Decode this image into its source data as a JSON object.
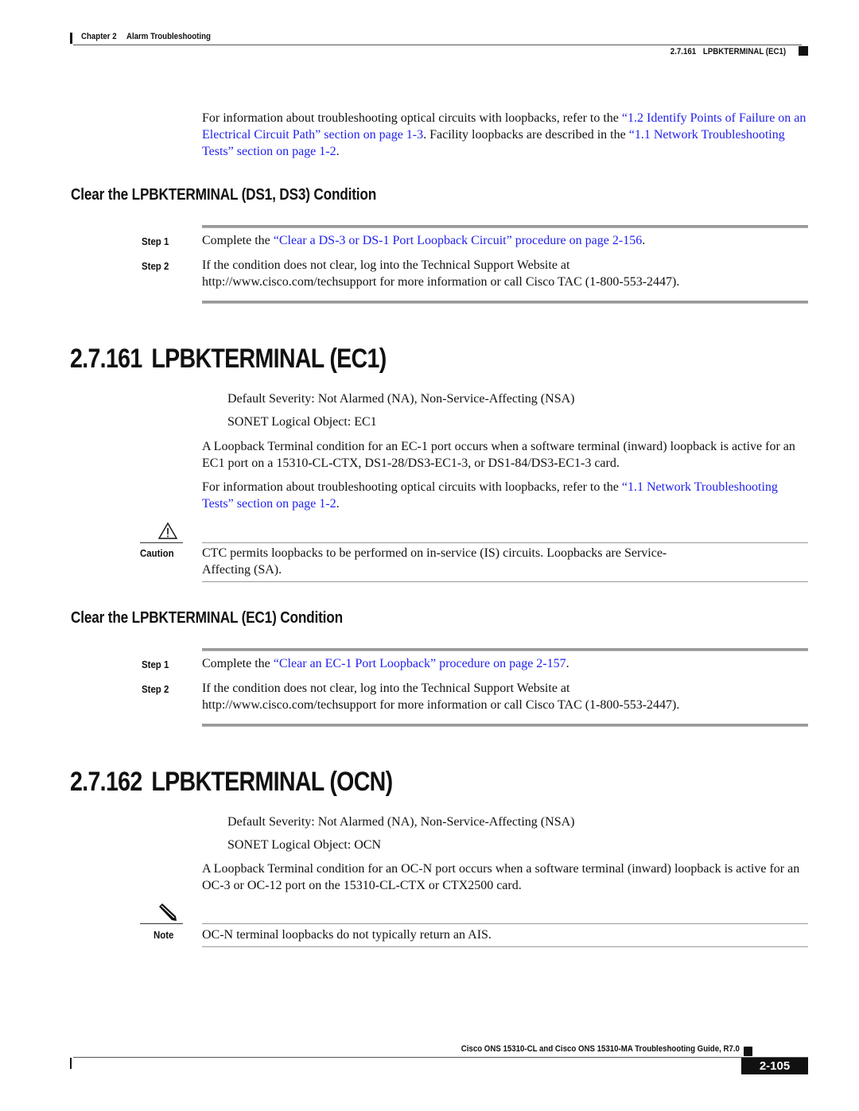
{
  "header": {
    "chapter": "Chapter 2",
    "chapter_title": "Alarm Troubleshooting",
    "section_number": "2.7.161",
    "section_title": "LPBKTERMINAL (EC1)"
  },
  "intro": {
    "text_before": "For information about troubleshooting optical circuits with loopbacks, refer to the ",
    "link1": "“1.2  Identify Points of Failure on an Electrical Circuit Path” section on page 1-3",
    "text_middle": ". Facility loopbacks are described in the ",
    "link2": "“1.1  Network Troubleshooting Tests” section on page 1-2",
    "text_after": "."
  },
  "clear_ds": {
    "heading": "Clear the LPBKTERMINAL (DS1, DS3) Condition",
    "steps": [
      {
        "label": "Step 1",
        "text_before": "Complete the ",
        "link": "“Clear a DS-3 or DS-1 Port Loopback Circuit” procedure on page 2-156",
        "text_after": "."
      },
      {
        "label": "Step 2",
        "line1": "If the condition does not clear, log into the Technical Support Website at",
        "line2": "http://www.cisco.com/techsupport for more information or call Cisco TAC (1-800-553-2447)."
      }
    ]
  },
  "section_ec1": {
    "number": "2.7.161",
    "title": "LPBKTERMINAL (EC1)",
    "severity": "Default Severity: Not Alarmed (NA), Non-Service-Affecting (NSA)",
    "logical_object": "SONET Logical Object: EC1",
    "description": "A Loopback Terminal condition for an EC-1 port occurs when a software terminal (inward) loopback is active for an EC1 port on a 15310-CL-CTX, DS1-28/DS3-EC1-3, or DS1-84/DS3-EC1-3 card.",
    "info_before": "For information about troubleshooting optical circuits with loopbacks, refer to the ",
    "info_link": "“1.1  Network Troubleshooting Tests” section on page 1-2",
    "info_after": ".",
    "caution": {
      "icon": "warning-triangle-icon",
      "label": "Caution",
      "text": "CTC permits loopbacks to be performed on in-service (IS) circuits. Loopbacks are Service-Affecting (SA)."
    }
  },
  "clear_ec1": {
    "heading": "Clear the LPBKTERMINAL (EC1) Condition",
    "steps": [
      {
        "label": "Step 1",
        "text_before": "Complete the ",
        "link": "“Clear an EC-1 Port Loopback” procedure on page 2-157",
        "text_after": "."
      },
      {
        "label": "Step 2",
        "line1": "If the condition does not clear, log into the Technical Support Website at",
        "line2": "http://www.cisco.com/techsupport for more information or call Cisco TAC (1-800-553-2447)."
      }
    ]
  },
  "section_ocn": {
    "number": "2.7.162",
    "title": "LPBKTERMINAL (OCN)",
    "severity": "Default Severity: Not Alarmed (NA), Non-Service-Affecting (NSA)",
    "logical_object": "SONET Logical Object: OCN",
    "description": "A Loopback Terminal condition for an OC-N port occurs when a software terminal (inward) loopback is active for an OC-3 or OC-12 port on the 15310-CL-CTX or CTX2500 card.",
    "note": {
      "icon": "pencil-note-icon",
      "label": "Note",
      "text": "OC-N terminal loopbacks do not typically return an AIS."
    }
  },
  "footer": {
    "guide_title": "Cisco ONS 15310-CL and Cisco ONS 15310-MA Troubleshooting Guide, R7.0",
    "page_number": "2-105"
  },
  "colors": {
    "link": "#2222ee",
    "text": "#111111",
    "rule": "#999999"
  }
}
